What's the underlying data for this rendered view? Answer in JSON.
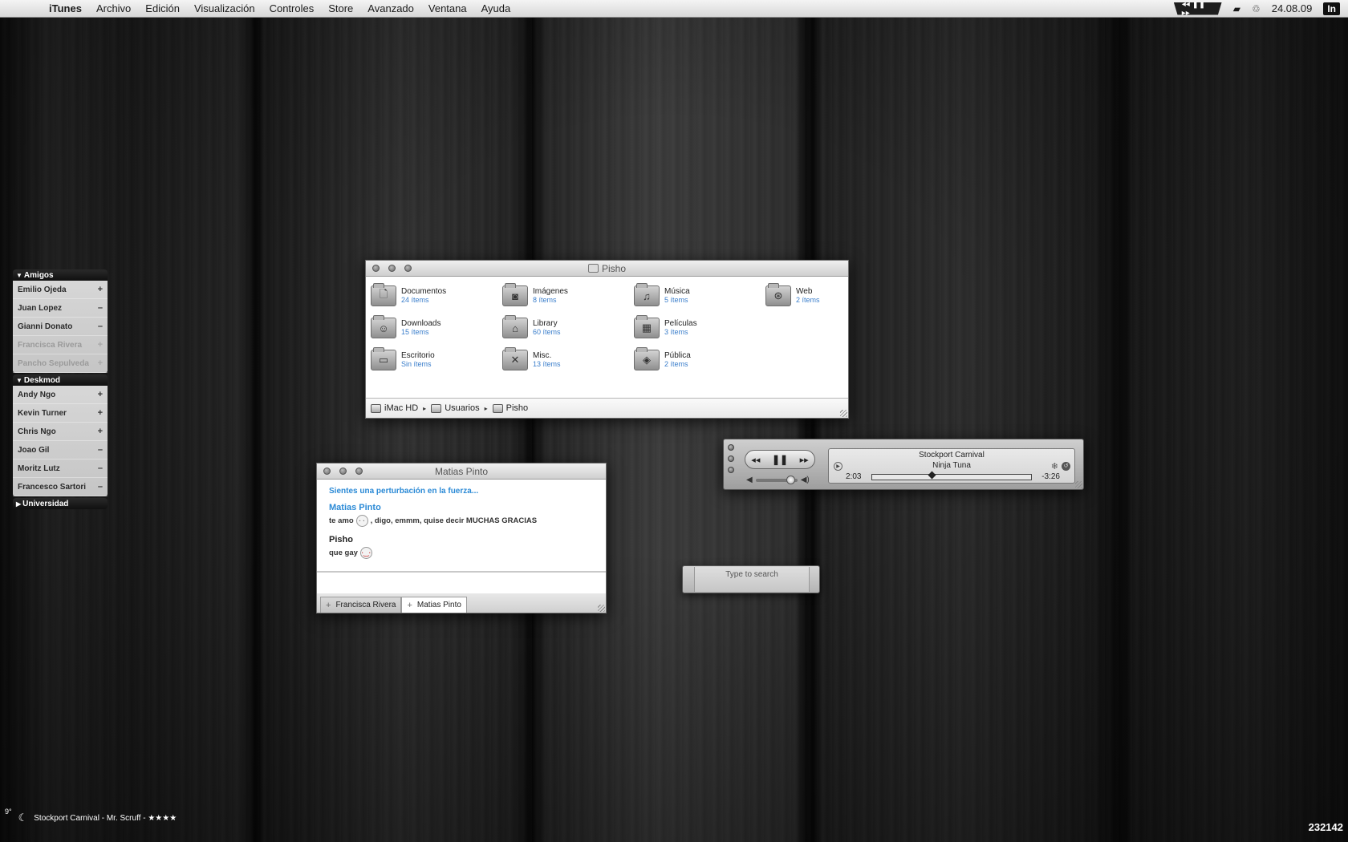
{
  "menubar": {
    "apple": "",
    "items": [
      "iTunes",
      "Archivo",
      "Edición",
      "Visualización",
      "Controles",
      "Store",
      "Avanzado",
      "Ventana",
      "Ayuda"
    ],
    "media_controls": "◂◂ ❚❚ ▸▸",
    "date": "24.08.09",
    "in_badge": "In"
  },
  "buddylist": {
    "groups": [
      {
        "name": "Amigos",
        "buddies": [
          {
            "name": "Emilio Ojeda",
            "status": "+"
          },
          {
            "name": "Juan Lopez",
            "status": "–"
          },
          {
            "name": "Gianni Donato",
            "status": "–"
          },
          {
            "name": "Francisca Rivera",
            "status": "+"
          },
          {
            "name": "Pancho Sepulveda",
            "status": "+"
          }
        ]
      },
      {
        "name": "Deskmod",
        "buddies": [
          {
            "name": "Andy Ngo",
            "status": "+"
          },
          {
            "name": "Kevin Turner",
            "status": "+"
          },
          {
            "name": "Chris Ngo",
            "status": "+"
          },
          {
            "name": "Joao Gil",
            "status": "–"
          },
          {
            "name": "Moritz Lutz",
            "status": "–"
          },
          {
            "name": "Francesco Sartori",
            "status": "–"
          }
        ]
      },
      {
        "name": "Universidad"
      }
    ]
  },
  "finder": {
    "title": "Pisho",
    "items": [
      {
        "name": "Documentos",
        "count": "24 ítems",
        "icon": "doc-icon",
        "glyph": "🗋"
      },
      {
        "name": "Imágenes",
        "count": "8 ítems",
        "icon": "camera-icon",
        "glyph": "◙"
      },
      {
        "name": "Música",
        "count": "5 ítems",
        "icon": "music-icon",
        "glyph": "♫"
      },
      {
        "name": "Web",
        "count": "2 ítems",
        "icon": "compass-icon",
        "glyph": "⊛"
      },
      {
        "name": "Downloads",
        "count": "15 ítems",
        "icon": "download-icon",
        "glyph": "☺"
      },
      {
        "name": "Library",
        "count": "60 ítems",
        "icon": "library-icon",
        "glyph": "⌂"
      },
      {
        "name": "Películas",
        "count": "3 ítems",
        "icon": "film-icon",
        "glyph": "▦"
      },
      {
        "name": "Escritorio",
        "count": "Sin ítems",
        "icon": "desktop-icon",
        "glyph": "▭"
      },
      {
        "name": "Misc.",
        "count": "13 ítems",
        "icon": "tools-icon",
        "glyph": "✕"
      },
      {
        "name": "Pública",
        "count": "2 ítems",
        "icon": "public-icon",
        "glyph": "◈"
      }
    ],
    "path": [
      "iMac HD",
      "Usuarios",
      "Pisho"
    ]
  },
  "chat": {
    "title": "Matias Pinto",
    "status": "Sientes una perturbación en la fuerza...",
    "messages": [
      {
        "sender": "Matias Pinto",
        "before": "te amo",
        "emoticon": "· ·",
        "after": ", digo, emmm, quise decir MUCHAS GRACIAS"
      },
      {
        "sender": "Pisho",
        "before": "que gay",
        "emoticon": "·‿·",
        "after": ""
      }
    ],
    "tabs": [
      "Francisca Rivera",
      "Matias Pinto"
    ],
    "tab_plus": "+"
  },
  "player": {
    "song": "Stockport Carnival",
    "artist": "Ninja Tuna",
    "elapsed": "2:03",
    "remaining": "-3:26",
    "progress": 0.37,
    "volume": 0.85,
    "prev": "◂◂",
    "pause": "❚❚",
    "next": "▸▸"
  },
  "search": {
    "placeholder": "Type to search"
  },
  "bottom": {
    "temperature": "9°",
    "now_playing": "Stockport Carnival - Mr. Scruff - ★★★★",
    "counter": "232142"
  }
}
